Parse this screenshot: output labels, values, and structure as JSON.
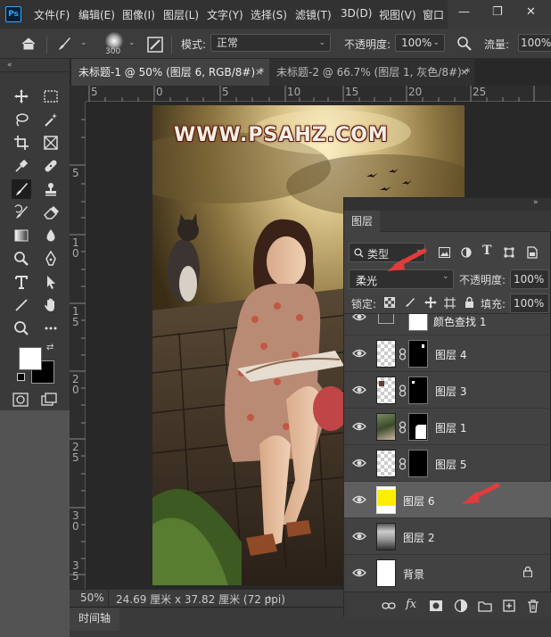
{
  "menubar": {
    "items": [
      "文件(F)",
      "编辑(E)",
      "图像(I)",
      "图层(L)",
      "文字(Y)",
      "选择(S)",
      "滤镜(T)",
      "3D(D)",
      "视图(V)",
      "窗口"
    ]
  },
  "options": {
    "brush_size": "300",
    "mode_label": "模式:",
    "mode_value": "正常",
    "opacity_label": "不透明度:",
    "opacity_value": "100%",
    "flow_label": "流量:",
    "flow_value": "100%"
  },
  "tabs": [
    {
      "label": "未标题-1 @ 50% (图层 6, RGB/8#) *",
      "close": "×"
    },
    {
      "label": "未标题-2 @ 66.7% (图层 1, 灰色/8#) *",
      "close": "×"
    }
  ],
  "ruler": {
    "top": [
      "5",
      "0",
      "5",
      "10",
      "15",
      "20",
      "25"
    ],
    "left": [
      "5",
      "1 0",
      "1 5",
      "2 0",
      "2 5",
      "3 0",
      "3 5"
    ]
  },
  "image": {
    "watermark": "WWW.PSAHZ.COM"
  },
  "status": {
    "zoom": "50%",
    "dimensions": "24.69 厘米 x 37.82 厘米 (72 ppi)",
    "arrow": "›"
  },
  "timeline": {
    "label": "时间轴"
  },
  "layers_panel": {
    "tab_label": "图层",
    "filter_label": "类型",
    "blend_mode": "柔光",
    "opacity_label": "不透明度:",
    "opacity_value": "100%",
    "lock_label": "锁定:",
    "fill_label": "填充:",
    "fill_value": "100%",
    "partial_layer": "颜色查找 1",
    "layers": [
      {
        "name": "图层 4"
      },
      {
        "name": "图层 3"
      },
      {
        "name": "图层 1"
      },
      {
        "name": "图层 5"
      },
      {
        "name": "图层 6"
      },
      {
        "name": "图层 2"
      },
      {
        "name": "背景"
      }
    ]
  },
  "colors": {
    "selected_layer_thumb": "#ffee00",
    "annotation_arrow": "#e03c3c"
  }
}
